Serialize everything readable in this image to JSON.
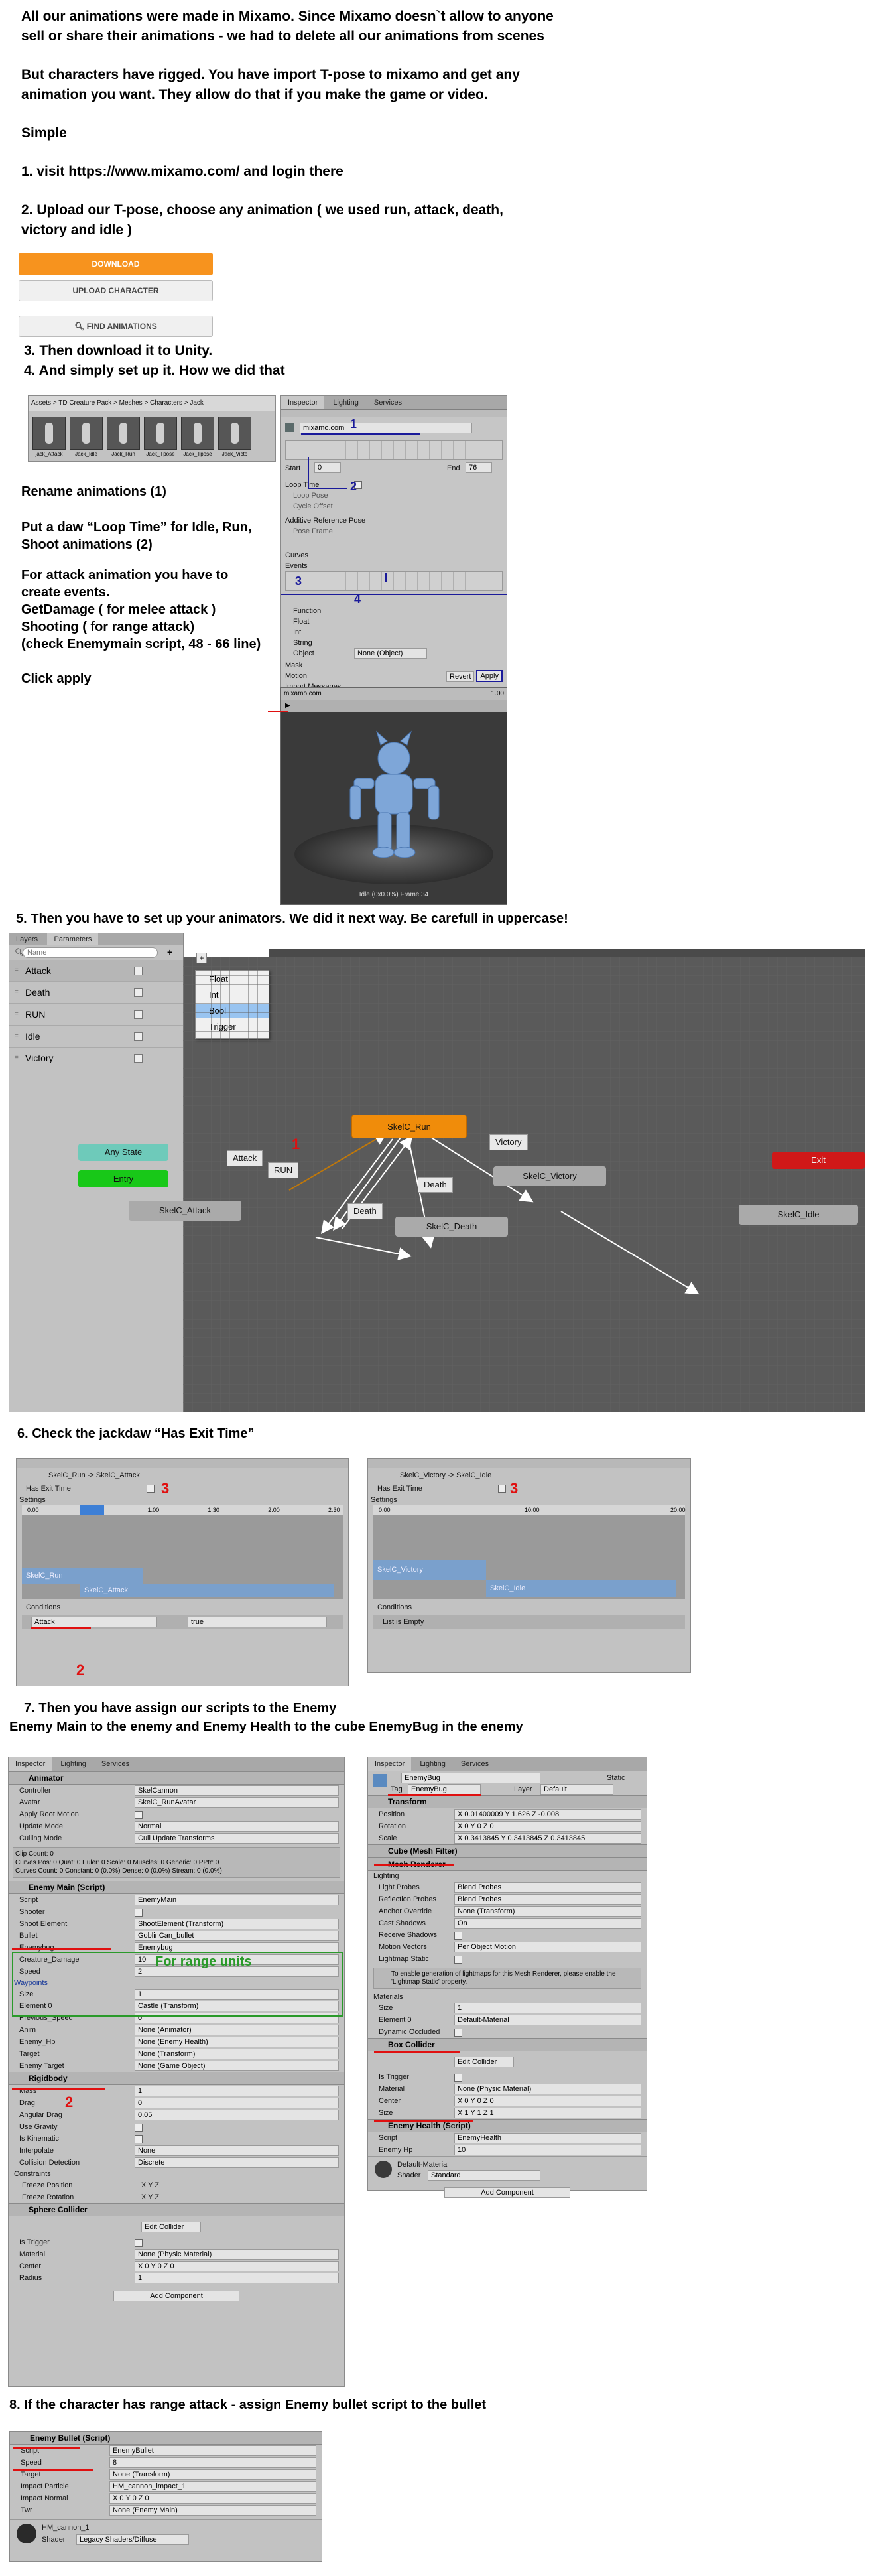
{
  "intro": {
    "line1": "All our animations were made in Mixamo. Since Mixamo doesn`t allow to anyone",
    "line2": "sell or share their animations - we had to delete all our animations from scenes",
    "line3": "But characters have rigged. You have import T-pose to mixamo and get any",
    "line4": "animation you want. They allow do that if you make the game or video.",
    "simple": "Simple",
    "step1": "1. visit https://www.mixamo.com/ and login there",
    "step2a": "2. Upload our T-pose, choose any animation ( we used run, attack, death,",
    "step2b": "victory and idle )"
  },
  "mixamo": {
    "download": "DOWNLOAD",
    "upload": "UPLOAD CHARACTER",
    "find": "FIND ANIMATIONS"
  },
  "steps34": {
    "step3": "3. Then download it to Unity.",
    "step4": "4. And simply set up it. How we did that"
  },
  "import_panel": {
    "breadcrumb": "Assets > TD Creature Pack > Meshes > Characters > Jack",
    "thumbs": [
      "jack_Attack",
      "Jack_Idle",
      "Jack_Run",
      "Jack_Tpose",
      "Jack_Tpose",
      "Jack_Victo"
    ],
    "tabs": [
      "Inspector",
      "Lighting",
      "Services"
    ],
    "clip_name": "mixamo.com",
    "start_label": "Start",
    "start_val": "0",
    "end_label": "End",
    "end_val": "76",
    "loop_time": "Loop Time",
    "loop_pose": "Loop Pose",
    "cycle_offset": "Cycle Offset",
    "additive": "Additive Reference Pose",
    "pose_frame": "Pose Frame",
    "curves": "Curves",
    "events": "Events",
    "function": "Function",
    "float": "Float",
    "int": "Int",
    "string": "String",
    "object": "Object",
    "object_val": "None (Object)",
    "mask": "Mask",
    "motion": "Motion",
    "import_messages": "Import Messages",
    "revert": "Revert",
    "apply": "Apply",
    "preview_title": "mixamo.com",
    "preview_speed": "1.00",
    "preview_caption": "Idle (0x0.0%) Frame 34",
    "num1": "1",
    "num2": "2",
    "num3": "3",
    "num4": "4"
  },
  "instructions": {
    "rename": "Rename animations (1)",
    "loop1": "Put a daw “Loop Time” for Idle, Run,",
    "loop2": "Shoot animations (2)",
    "events1": "For attack animation you have to",
    "events2": "create events.",
    "events3": "GetDamage ( for melee attack )",
    "events4": "Shooting ( for range attack)",
    "events5": "(check Enemymain script, 48 - 66 line)",
    "apply": "Click apply"
  },
  "step5": "5. Then you have to set up your animators. We did it next way. Be carefull in uppercase!",
  "animator": {
    "tabs": [
      "Layers",
      "Parameters"
    ],
    "search_placeholder": "Name",
    "params": [
      "Attack",
      "Death",
      "RUN",
      "Idle",
      "Victory"
    ],
    "menu": [
      "Float",
      "Int",
      "Bool",
      "Trigger"
    ],
    "nodes": {
      "run": "SkelC_Run",
      "any": "Any State",
      "entry": "Entry",
      "exit": "Exit",
      "victory": "SkelC_Victory",
      "attack": "SkelC_Attack",
      "death": "SkelC_Death",
      "idle": "SkelC_Idle"
    },
    "labels": {
      "victory": "Victory",
      "attack": "Attack",
      "run": "RUN",
      "death1": "Death",
      "death2": "Death"
    },
    "num1": "1"
  },
  "step6": "6. Check the jackdaw “Has Exit Time”",
  "transitions": [
    {
      "title": "SkelC_Run -> SkelC_Attack",
      "has_exit": "Has Exit Time",
      "settings": "Settings",
      "ticks": [
        "0:00",
        "0:30",
        "1:00",
        "1:30",
        "2:00",
        "2:30"
      ],
      "bar1": "SkelC_Run",
      "bar2": "SkelC_Attack",
      "conditions": "Conditions",
      "cond_param": "Attack",
      "cond_value": "true",
      "num": "3",
      "num2": "2"
    },
    {
      "title": "SkelC_Victory -> SkelC_Idle",
      "has_exit": "Has Exit Time",
      "settings": "Settings",
      "ticks": [
        "0:00",
        "10:00",
        "20:00"
      ],
      "bar1": "SkelC_Victory",
      "bar2": "SkelC_Idle",
      "conditions": "Conditions",
      "cond_empty": "List is Empty",
      "num": "3"
    }
  ],
  "step7a": "7. Then you have assign our scripts to the Enemy",
  "step7b": "Enemy Main to the enemy and Enemy Health to the cube EnemyBug in the enemy",
  "enemy_inspector": {
    "tabs": [
      "Inspector",
      "Lighting",
      "Services"
    ],
    "animator": "Animator",
    "rows_anim": [
      [
        "Controller",
        "SkelCannon"
      ],
      [
        "Avatar",
        "SkelC_RunAvatar"
      ],
      [
        "Apply Root Motion",
        ""
      ],
      [
        "Update Mode",
        "Normal"
      ],
      [
        "Culling Mode",
        "Cull Update Transforms"
      ]
    ],
    "clip_info": "Clip Count: 0",
    "clip_info2": "Curves Pos: 0 Quat: 0 Euler: 0 Scale: 0 Muscles: 0 Generic: 0 PPtr: 0",
    "clip_info3": "Curves Count: 0 Constant: 0 (0.0%) Dense: 0 (0.0%) Stream: 0 (0.0%)",
    "main": "Enemy Main (Script)",
    "rows_main": [
      [
        "Script",
        "EnemyMain"
      ],
      [
        "Shooter",
        ""
      ],
      [
        "Shoot Element",
        "ShootElement (Transform)"
      ],
      [
        "Bullet",
        "GoblinCan_bullet"
      ],
      [
        "Enemybug",
        "Enemybug"
      ],
      [
        "Creature_Damage",
        "10"
      ],
      [
        "Speed",
        "2"
      ]
    ],
    "range_note": "For range units",
    "waypoints": "Waypoints",
    "rows_wp": [
      [
        "Size",
        "1"
      ],
      [
        "Element 0",
        "Castle (Transform)"
      ],
      [
        "Previous_Speed",
        "0"
      ],
      [
        "Anim",
        "None (Animator)"
      ],
      [
        "Enemy_Hp",
        "None (Enemy Health)"
      ],
      [
        "Target",
        "None (Transform)"
      ],
      [
        "Enemy Target",
        "None (Game Object)"
      ]
    ],
    "rigidbody": "Rigidbody",
    "rows_rb": [
      [
        "Mass",
        "1"
      ],
      [
        "Drag",
        "0"
      ],
      [
        "Angular Drag",
        "0.05"
      ],
      [
        "Use Gravity",
        ""
      ],
      [
        "Is Kinematic",
        ""
      ],
      [
        "Interpolate",
        "None"
      ],
      [
        "Collision Detection",
        "Discrete"
      ]
    ],
    "constraints": "Constraints",
    "freeze_pos": "Freeze Position",
    "freeze_rot": "Freeze Rotation",
    "xyz": "X  Y  Z",
    "sphere": "Sphere Collider",
    "edit_collider": "Edit Collider",
    "rows_sc": [
      [
        "Is Trigger",
        ""
      ],
      [
        "Material",
        "None (Physic Material)"
      ],
      [
        "Center",
        "X 0   Y 0   Z 0"
      ],
      [
        "Radius",
        "1"
      ]
    ],
    "add_component": "Add Component",
    "num2": "2"
  },
  "bug_inspector": {
    "tabs": [
      "Inspector",
      "Lighting",
      "Services"
    ],
    "name": "EnemyBug",
    "static": "Static",
    "tag_label": "Tag",
    "tag": "EnemyBug",
    "layer_label": "Layer",
    "layer": "Default",
    "transform": "Transform",
    "rows_t": [
      [
        "Position",
        "X 0.01400009   Y 1.626   Z -0.008"
      ],
      [
        "Rotation",
        "X 0   Y 0   Z 0"
      ],
      [
        "Scale",
        "X 0.3413845   Y 0.3413845   Z 0.3413845"
      ]
    ],
    "meshfilter": "Cube (Mesh Filter)",
    "meshrenderer": "Mesh Renderer",
    "lighting": "Lighting",
    "rows_mr": [
      [
        "Light Probes",
        "Blend Probes"
      ],
      [
        "Reflection Probes",
        "Blend Probes"
      ],
      [
        "Anchor Override",
        "None (Transform)"
      ],
      [
        "Cast Shadows",
        "On"
      ],
      [
        "Receive Shadows",
        ""
      ],
      [
        "Motion Vectors",
        "Per Object Motion"
      ],
      [
        "Lightmap Static",
        ""
      ]
    ],
    "lightmap_note": "To enable generation of lightmaps for this Mesh Renderer, please enable the 'Lightmap Static' property.",
    "materials": "Materials",
    "rows_mat": [
      [
        "Size",
        "1"
      ],
      [
        "Element 0",
        "Default-Material"
      ],
      [
        "Dynamic Occluded",
        ""
      ]
    ],
    "box": "Box Collider",
    "edit_collider": "Edit Collider",
    "rows_box": [
      [
        "Is Trigger",
        ""
      ],
      [
        "Material",
        "None (Physic Material)"
      ],
      [
        "Center",
        "X 0   Y 0   Z 0"
      ],
      [
        "Size",
        "X 1   Y 1   Z 1"
      ]
    ],
    "health": "Enemy Health (Script)",
    "rows_h": [
      [
        "Script",
        "EnemyHealth"
      ],
      [
        "Enemy Hp",
        "10"
      ]
    ],
    "material_name": "Default-Material",
    "shader_label": "Shader",
    "shader": "Standard",
    "add_component": "Add Component"
  },
  "step8": "8. If the character has range attack - assign Enemy bullet script to the bullet",
  "bullet_inspector": {
    "header": "Enemy Bullet (Script)",
    "rows": [
      [
        "Script",
        "EnemyBullet"
      ],
      [
        "Speed",
        "8"
      ],
      [
        "Target",
        "None (Transform)"
      ],
      [
        "Impact Particle",
        "HM_cannon_impact_1"
      ],
      [
        "Impact Normal",
        "X 0   Y 0   Z 0"
      ],
      [
        "Twr",
        "None (Enemy Main)"
      ]
    ],
    "material_name": "HM_cannon_1",
    "shader_label": "Shader",
    "shader": "Legacy Shaders/Diffuse"
  }
}
